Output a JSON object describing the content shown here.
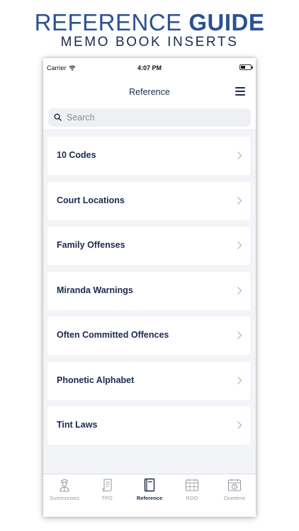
{
  "headline": {
    "line1_light": "REFERENCE ",
    "line1_bold": "GUIDE",
    "line2": "MEMO BOOK INSERTS"
  },
  "status_bar": {
    "carrier": "Carrier",
    "time": "4:07 PM"
  },
  "nav": {
    "title": "Reference",
    "menu_icon": "hamburger-menu-icon"
  },
  "search": {
    "placeholder": "Search"
  },
  "list": {
    "items": [
      {
        "label": "10 Codes"
      },
      {
        "label": "Court Locations"
      },
      {
        "label": "Family Offenses"
      },
      {
        "label": "Miranda Warnings"
      },
      {
        "label": "Often Committed Offences"
      },
      {
        "label": "Phonetic Alphabet"
      },
      {
        "label": "Tint Laws"
      }
    ]
  },
  "tabs": [
    {
      "label": "Summonses",
      "icon": "officer-icon",
      "active": false
    },
    {
      "label": "TPO",
      "icon": "document-scroll-icon",
      "active": false
    },
    {
      "label": "Reference",
      "icon": "book-icon",
      "active": true
    },
    {
      "label": "RDO",
      "icon": "calendar-icon",
      "active": false
    },
    {
      "label": "Overtime",
      "icon": "calendar-clock-icon",
      "active": false
    }
  ],
  "colors": {
    "brand_blue": "#2a5291",
    "navy_text": "#1b2a4e",
    "inactive_tab": "#9a9ca3",
    "list_background": "#f3f4f8"
  }
}
